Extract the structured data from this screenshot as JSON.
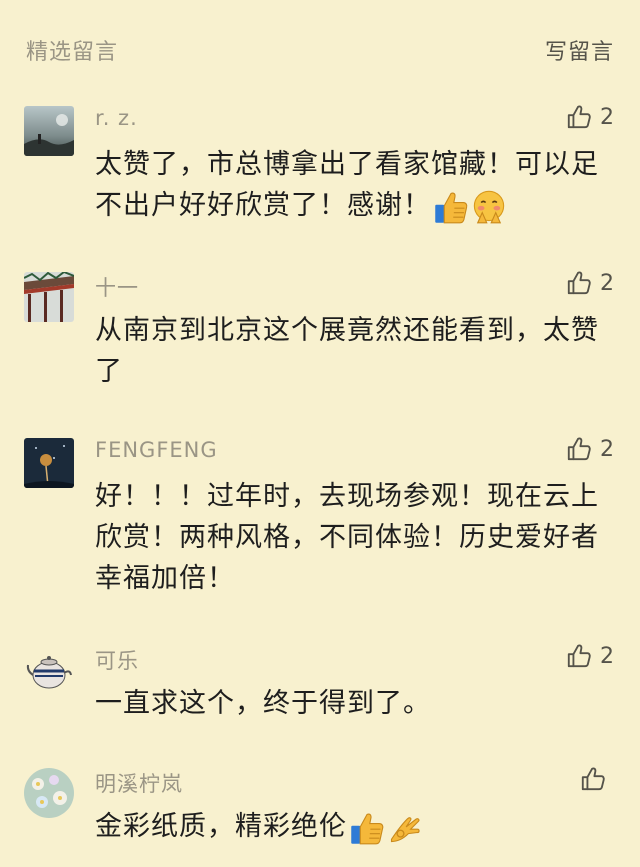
{
  "header": {
    "title": "精选留言",
    "write_label": "写留言"
  },
  "comments": [
    {
      "nickname": "r. z.",
      "likes": "2",
      "text": "太赞了，市总博拿出了看家馆藏！可以足不出户好好欣赏了！感谢！",
      "emojis": [
        "thumbs-up-emoji",
        "flushed-hands-emoji"
      ]
    },
    {
      "nickname": "十一",
      "likes": "2",
      "text": "从南京到北京这个展竟然还能看到，太赞了",
      "emojis": []
    },
    {
      "nickname": "FENGFENG",
      "likes": "2",
      "text": "好！！！过年时，去现场参观！现在云上欣赏！两种风格，不同体验！历史爱好者幸福加倍！",
      "emojis": []
    },
    {
      "nickname": "可乐",
      "likes": "2",
      "text": "一直求这个，终于得到了。",
      "emojis": []
    },
    {
      "nickname": "明溪柠岚",
      "likes": "",
      "text": "金彩纸质，精彩绝伦",
      "emojis": [
        "thumbs-up-emoji",
        "ok-hand-emoji"
      ]
    }
  ],
  "colors": {
    "background": "#f8f1cf",
    "muted_text": "#9a9585",
    "body_text": "#1e1e1e",
    "like_icon": "#55534a"
  }
}
